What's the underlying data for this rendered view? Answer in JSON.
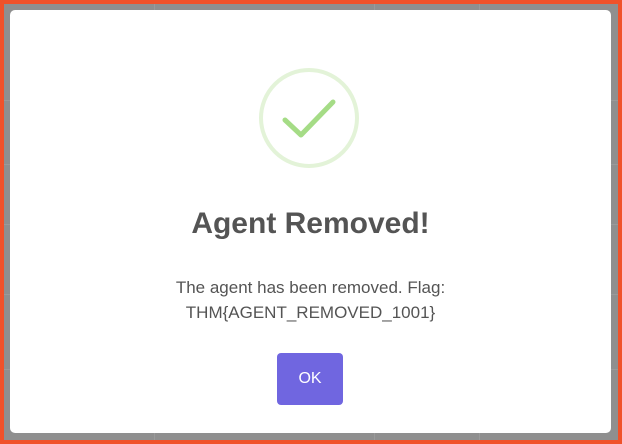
{
  "dialog": {
    "title": "Agent Removed!",
    "message_line1": "The agent has been removed. Flag:",
    "message_line2": "THM{AGENT_REMOVED_1001}",
    "ok_label": "OK",
    "icon": "checkmark-icon",
    "type": "success"
  },
  "colors": {
    "accent": "#7066e0",
    "success": "#a5dc86",
    "success_ring": "#e3f3d8",
    "text": "#545454",
    "frame": "#f0522a"
  }
}
